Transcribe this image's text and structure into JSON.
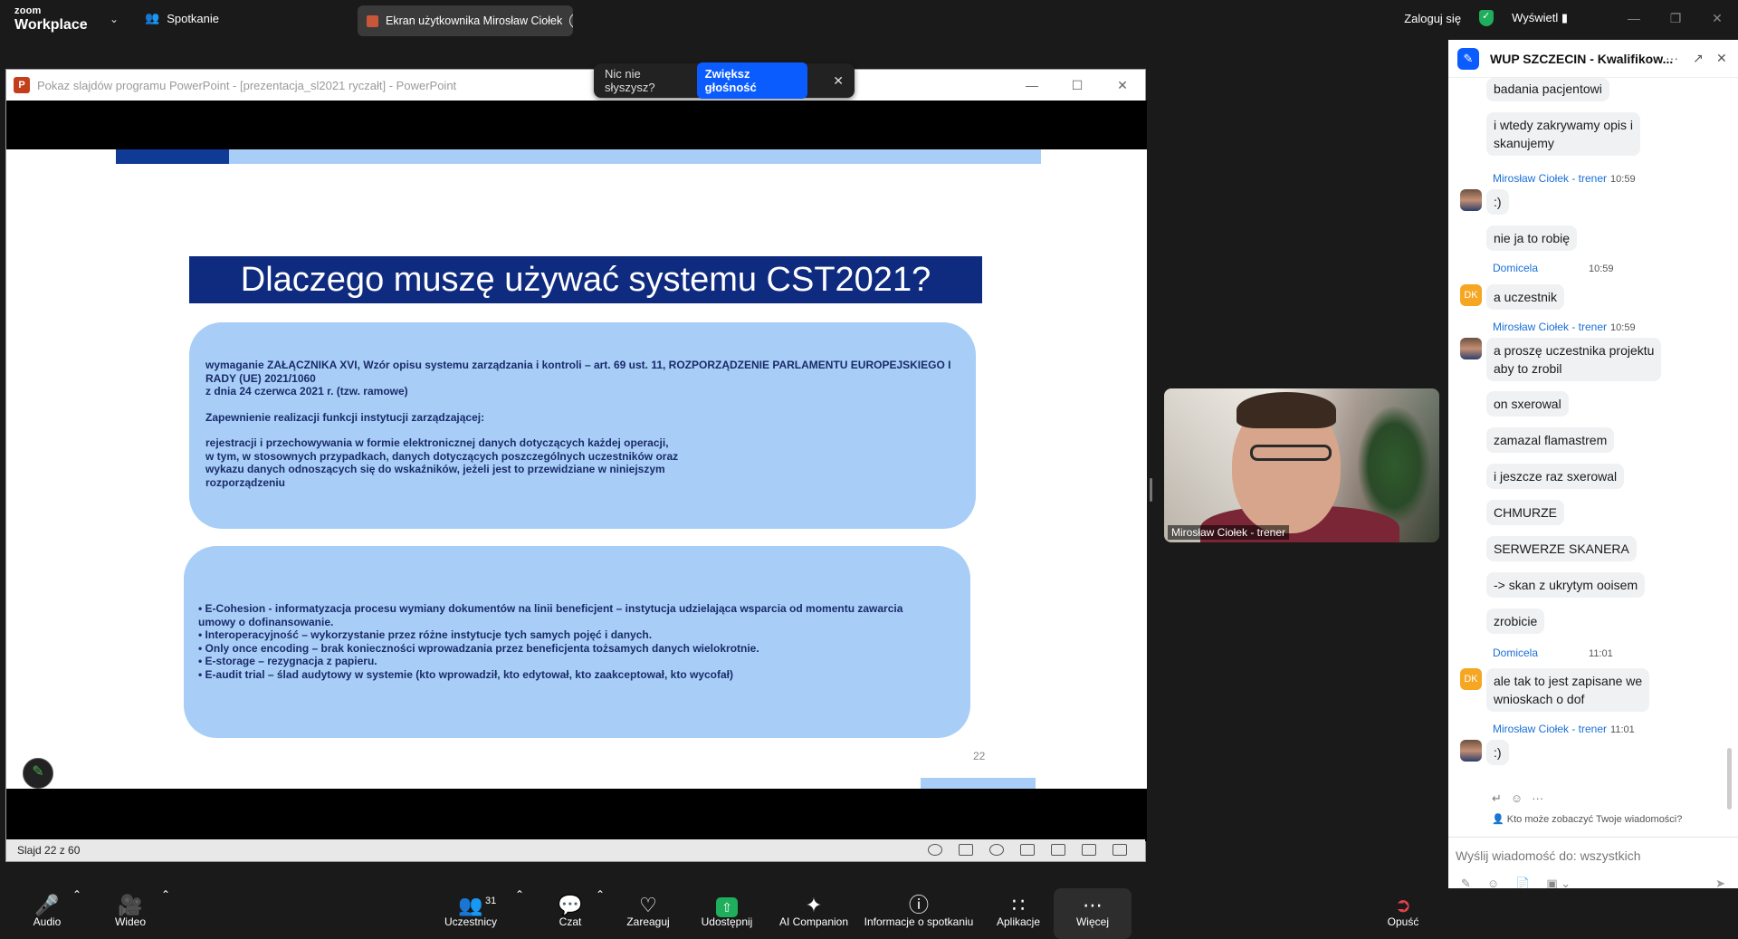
{
  "app": {
    "logo_top": "zoom",
    "logo_bottom": "Workplace",
    "meeting_label": "Spotkanie",
    "share_tab": "Ekran użytkownika Mirosław Ciołek",
    "login": "Zaloguj się",
    "view": "Wyświetl"
  },
  "toast": {
    "question": "Nic nie słyszysz?",
    "button": "Zwiększ głośność"
  },
  "ppt": {
    "window_title": "Pokaz slajdów programu PowerPoint - [prezentacja_sl2021 ryczałt] - PowerPoint",
    "status": "Slajd 22 z 60",
    "slide_title": "Dlaczego muszę używać systemu CST2021?",
    "box1": [
      "wymaganie ZAŁĄCZNIKA XVI, Wzór opisu systemu zarządzania i kontroli – art. 69 ust. 11, ROZPORZĄDZENIE PARLAMENTU EUROPEJSKIEGO I RADY (UE) 2021/1060\nz dnia 24 czerwca 2021 r. (tzw. ramowe)",
      "Zapewnienie realizacji funkcji instytucji zarządzającej:",
      "rejestracji i przechowywania w formie elektronicznej danych dotyczących każdej operacji,\nw tym, w stosownych przypadkach, danych dotyczących poszczególnych uczestników oraz\nwykazu danych odnoszących się do wskaźników, jeżeli jest to przewidziane w niniejszym\nrozporządzeniu"
    ],
    "box2": [
      "• E-Cohesion - informatyzacja procesu wymiany dokumentów na linii beneficjent – instytucja udzielająca wsparcia od momentu zawarcia\numowy o dofinansowanie.",
      "• Interoperacyjność – wykorzystanie przez różne instytucje tych samych pojęć i danych.",
      "• Only once encoding – brak konieczności wprowadzania przez beneficjenta tożsamych danych wielokrotnie.",
      "• E-storage – rezygnacja z papieru.",
      "• E-audit trial – ślad audytowy w systemie (kto wprowadził, kto edytował, kto zaakceptował, kto wycofał)"
    ],
    "slide_number": "22"
  },
  "video": {
    "name": "Mirosław Ciołek - trener"
  },
  "chat": {
    "title": "WUP SZCZECIN - Kwalifikow...",
    "messages": [
      {
        "text": "badania pacjentowi"
      },
      {
        "text": "i wtedy zakrywamy opis i\nskanujemy"
      },
      {
        "sender": "Mirosław Ciołek - trener",
        "time": "10:59",
        "text": ":)"
      },
      {
        "text": "nie ja to robię"
      },
      {
        "sender": "Domicela",
        "time": "10:59",
        "text": "a uczestnik"
      },
      {
        "sender": "Mirosław Ciołek - trener",
        "time": "10:59",
        "text": "a proszę uczestnika projektu\naby to zrobil"
      },
      {
        "text": "on sxerowal"
      },
      {
        "text": "zamazal flamastrem"
      },
      {
        "text": "i jeszcze raz sxerowal"
      },
      {
        "text": "CHMURZE"
      },
      {
        "text": "SERWERZE SKANERA"
      },
      {
        "text": "-> skan z ukrytym ooisem"
      },
      {
        "text": "zrobicie"
      },
      {
        "sender": "Domicela",
        "time": "11:01",
        "text": "ale tak to jest zapisane we\nwnioskach o dof"
      },
      {
        "sender": "Mirosław Ciołek - trener",
        "time": "11:01",
        "text": ":)"
      }
    ],
    "avatar_initials": "DK",
    "who_sees": "Kto może zobaczyć Twoje wiadomości?",
    "input_placeholder": "Wyślij wiadomość do: wszystkich"
  },
  "toolbar": {
    "audio": "Audio",
    "video": "Wideo",
    "participants": "Uczestnicy",
    "participants_count": "31",
    "chat": "Czat",
    "react": "Zareaguj",
    "share": "Udostępnij",
    "ai": "AI Companion",
    "info": "Informacje o spotkaniu",
    "apps": "Aplikacje",
    "more": "Więcej",
    "leave": "Opuść"
  },
  "colors": {
    "brand_blue": "#0b5cff",
    "slide_dark_blue": "#0f2b7f",
    "slide_light_blue": "#a8cef7",
    "share_green": "#1fae5b",
    "muted_red": "#e8414a"
  }
}
